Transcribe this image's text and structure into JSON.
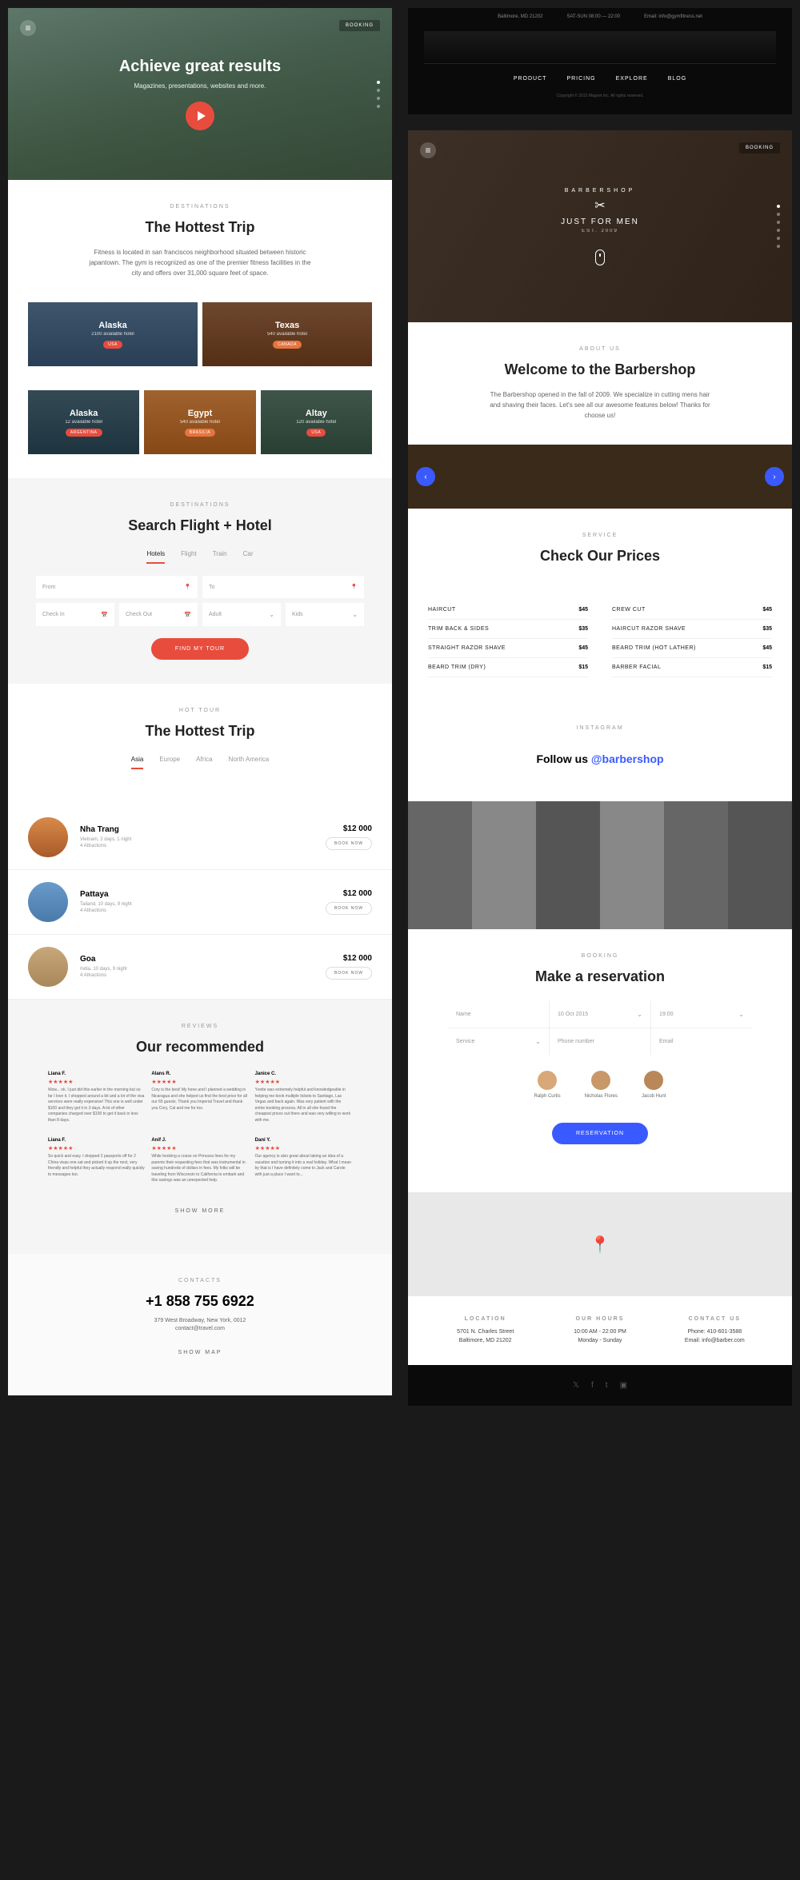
{
  "travel": {
    "hero": {
      "title": "Achieve great results",
      "subtitle": "Magazines, presentations, websites and more.",
      "booking": "BOOKING"
    },
    "destinations": {
      "eyebrow": "DESTINATIONS",
      "title": "The Hottest Trip",
      "desc": "Fitness is located in san franciscos neighborhood situated between historic japantown. The gym is recognized as one of the premier fitness facilities in the city and offers over 31,000 square feet of space.",
      "cards": [
        {
          "name": "Alaska",
          "sub": "2100 available hotel",
          "tag": "USA"
        },
        {
          "name": "Texas",
          "sub": "540 available hotel",
          "tag": "CANADA"
        },
        {
          "name": "Alaska",
          "sub": "12 available hotel",
          "tag": "ARGENTINA"
        },
        {
          "name": "Egypt",
          "sub": "540 available hotel",
          "tag": "BRASILIA"
        },
        {
          "name": "Altay",
          "sub": "120 available hotel",
          "tag": "USA"
        }
      ]
    },
    "search": {
      "eyebrow": "DESTINATIONS",
      "title": "Search Flight + Hotel",
      "tabs": [
        "Hotels",
        "Flight",
        "Train",
        "Car"
      ],
      "fields": {
        "from": "From",
        "to": "To",
        "checkin": "Check In",
        "checkout": "Check Out",
        "adult": "Adult",
        "kids": "Kids"
      },
      "button": "FIND MY TOUR"
    },
    "hottour": {
      "eyebrow": "HOT TOUR",
      "title": "The Hottest Trip",
      "tabs": [
        "Asia",
        "Europe",
        "Africa",
        "North America"
      ],
      "tours": [
        {
          "name": "Nha Trang",
          "meta1": "Vietnam, 2 days, 1 night",
          "meta2": "4 Attractions",
          "price": "$12 000",
          "btn": "BOOK NOW"
        },
        {
          "name": "Pattaya",
          "meta1": "Tailand, 10 days, 9 night",
          "meta2": "4 Attractions",
          "price": "$12 000",
          "btn": "BOOK NOW"
        },
        {
          "name": "Goa",
          "meta1": "India, 10 days, 9 night",
          "meta2": "4 Attractions",
          "price": "$12 000",
          "btn": "BOOK NOW"
        }
      ]
    },
    "reviews": {
      "eyebrow": "REVIEWS",
      "title": "Our recommended",
      "items": [
        {
          "name": "Liana F.",
          "text": "Wow... ok. I just did this earlier in the morning but so far I love it. I shopped around a bit and a lot of the visa services were really expensive! This one is well under $100 and they got it in 3 days. A lot of other companies charged over $100 to get it back in less than 8 days."
        },
        {
          "name": "Alans R.",
          "text": "Cory is the best! My hone and I planned a wedding in Nicaragua and she helped us find the best price for all our 65 guests. Thank you Imperial Travel and thank you Cory, Cal and me for too."
        },
        {
          "name": "Janice C.",
          "text": "Yvette was extremely helpful and knowledgeable in helping me book multiple tickets to Santiago, Las Vegas and back again. Was very patient with the entire booking process. All in all she found the cheapest prices out there and was very willing to work with me."
        },
        {
          "name": "Liana F.",
          "text": "So quick and easy. I dropped 2 passports off for 2 China visas one sat and picked it up the next, very friendly and helpful they actually respond really quickly to messages too."
        },
        {
          "name": "Anif J.",
          "text": "While booking a cruise on Princess lines for my parents their requesting fees that was instrumental in saving hundreds of dollars in fees. My folks will be traveling from Wisconsin to California to embark and this savings was an unexpected help."
        },
        {
          "name": "Dani Y.",
          "text": "Our agency is also great about taking an idea of a vacation and turning it into a real holiday. What I mean by that is I have definitely come to Jack and Carole with just a place I want to..."
        }
      ],
      "showmore": "SHOW MORE"
    },
    "contacts": {
      "eyebrow": "CONTACTS",
      "phone": "+1 858 755 6922",
      "address": "379 West Broadway, New York, 0012",
      "email": "contact@travel.com",
      "showmap": "SHOW MAP"
    }
  },
  "barber": {
    "top": {
      "address": "Baltimore, MD 21202",
      "hours": "SAT-SUN 08:00 — 22:00",
      "email": "Email: info@gymfitness.net",
      "nav": [
        "PRODUCT",
        "PRICING",
        "EXPLORE",
        "BLOG"
      ],
      "copy": "Copyright © 2015 Magnet Inc. All rights reserved."
    },
    "hero": {
      "arc": "BARBERSHOP",
      "tag": "JUST FOR MEN",
      "est": "EST. 2009",
      "booking": "BOOKING"
    },
    "about": {
      "eyebrow": "ABOUT US",
      "title": "Welcome to the Barbershop",
      "desc": "The Barbershop opened in the fall of 2009. We specialize in cutting mens hair and shaving their faces. Let's see all our awesome features below! Thanks for choose us!"
    },
    "service": {
      "eyebrow": "SERVICE",
      "title": "Check Our Prices",
      "left": [
        {
          "name": "HAIRCUT",
          "val": "$45"
        },
        {
          "name": "TRIM BACK & SIDES",
          "val": "$35"
        },
        {
          "name": "STRAIGHT RAZOR SHAVE",
          "val": "$45"
        },
        {
          "name": "BEARD TRIM (DRY)",
          "val": "$15"
        }
      ],
      "right": [
        {
          "name": "CREW CUT",
          "val": "$45"
        },
        {
          "name": "HAIRCUT RAZOR SHAVE",
          "val": "$35"
        },
        {
          "name": "BEARD TRIM (HOT LATHER)",
          "val": "$45"
        },
        {
          "name": "BARBER FACIAL",
          "val": "$15"
        }
      ]
    },
    "instagram": {
      "eyebrow": "INSTAGRAM",
      "text": "Follow us ",
      "handle": "@barbershop"
    },
    "booking": {
      "eyebrow": "BOOKING",
      "title": "Make a reservation",
      "fields": {
        "name": "Name",
        "date": "10 Oct 2015",
        "time": "19:00",
        "service": "Service",
        "phone": "Phone number",
        "email": "Email"
      },
      "barbers": [
        "Ralph Curtis",
        "Nicholas Flores",
        "Jacob Hunt"
      ],
      "button": "RESERVATION"
    },
    "footer": {
      "location": {
        "title": "LOCATION",
        "l1": "5701 N. Charles Street",
        "l2": "Baltimore, MD 21202"
      },
      "hours": {
        "title": "OUR HOURS",
        "l1": "10:00 AM - 22:00 PM",
        "l2": "Monday - Sunday"
      },
      "contact": {
        "title": "CONTACT US",
        "l1": "Phone: 410-601-3588",
        "l2": "Email: info@barber.com"
      }
    }
  }
}
